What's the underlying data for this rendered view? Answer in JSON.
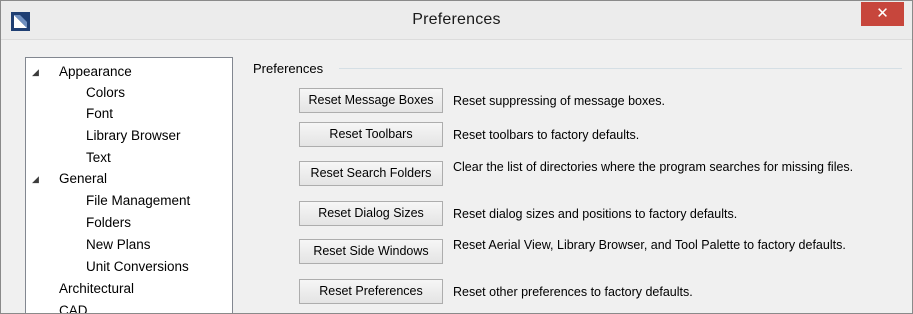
{
  "window": {
    "title": "Preferences",
    "close_glyph": "✕",
    "app_icon": "chief-architect-logo-icon"
  },
  "tree": {
    "expand_glyph": "◢",
    "items": [
      {
        "label": "Appearance",
        "level": 0,
        "expanded": true
      },
      {
        "label": "Colors",
        "level": 1
      },
      {
        "label": "Font",
        "level": 1
      },
      {
        "label": "Library Browser",
        "level": 1
      },
      {
        "label": "Text",
        "level": 1
      },
      {
        "label": "General",
        "level": 0,
        "expanded": true
      },
      {
        "label": "File Management",
        "level": 1
      },
      {
        "label": "Folders",
        "level": 1
      },
      {
        "label": "New Plans",
        "level": 1
      },
      {
        "label": "Unit Conversions",
        "level": 1
      },
      {
        "label": "Architectural",
        "level": 0
      },
      {
        "label": "CAD",
        "level": 0
      }
    ]
  },
  "panel": {
    "group_label": "Preferences",
    "actions": [
      {
        "button": "Reset Message Boxes",
        "description": "Reset suppressing of message boxes."
      },
      {
        "button": "Reset Toolbars",
        "description": "Reset toolbars to factory defaults."
      },
      {
        "button": "Reset Search Folders",
        "description": "Clear the list of directories where the program searches for missing files."
      },
      {
        "button": "Reset Dialog Sizes",
        "description": "Reset dialog sizes and positions to factory defaults."
      },
      {
        "button": "Reset Side Windows",
        "description": "Reset Aerial View, Library Browser, and Tool Palette to factory defaults."
      },
      {
        "button": "Reset Preferences",
        "description": "Reset other preferences to factory defaults."
      }
    ]
  }
}
